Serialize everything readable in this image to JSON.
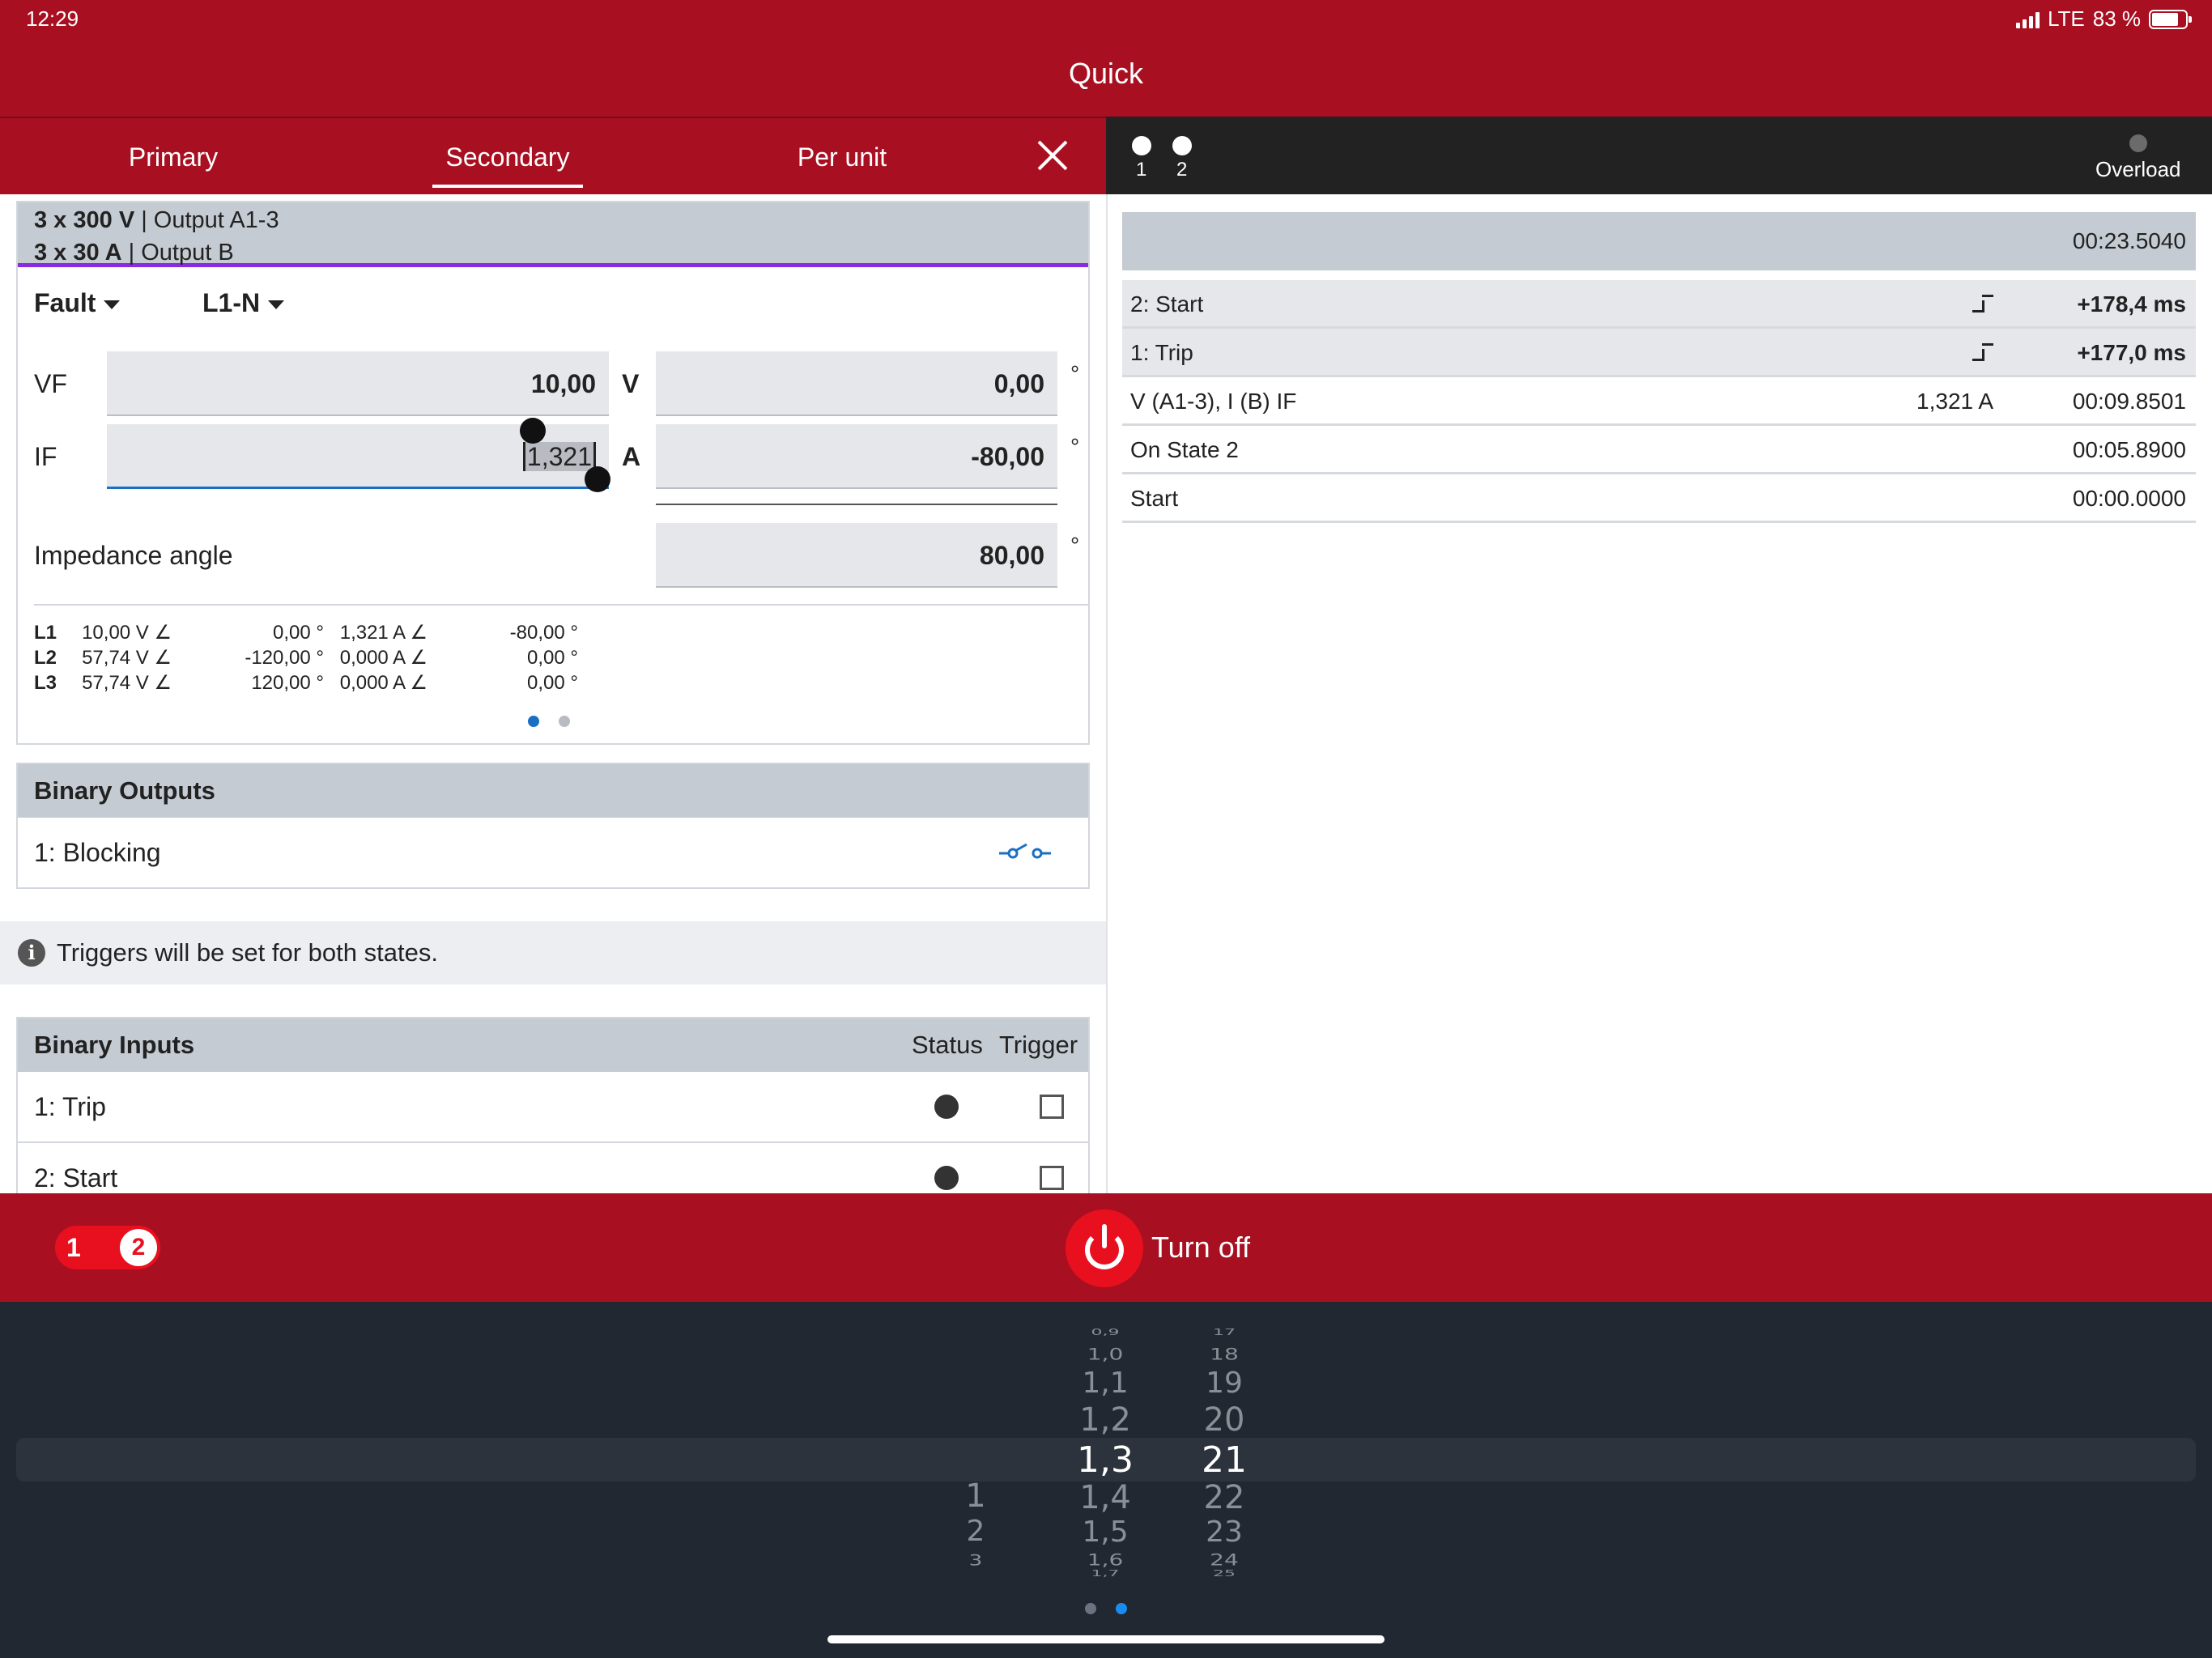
{
  "status_bar": {
    "time": "12:29",
    "network": "LTE",
    "battery": "83 %"
  },
  "app": {
    "title": "Quick"
  },
  "tabs": [
    {
      "label": "Primary"
    },
    {
      "label": "Secondary",
      "active": true
    },
    {
      "label": "Per unit"
    }
  ],
  "states_bar": {
    "states": [
      "1",
      "2"
    ],
    "overload_label": "Overload"
  },
  "output_config": {
    "voltage_range": "3 x 300 V",
    "voltage_output": "| Output A1-3",
    "current_range": "3 x 30 A",
    "current_output": "| Output B"
  },
  "selectors": {
    "fault_mode": "Fault",
    "loop": "L1-N"
  },
  "inputs": {
    "vf": {
      "label": "VF",
      "value": "10,00",
      "unit": "V",
      "angle": "0,00",
      "angle_unit": "°"
    },
    "if": {
      "label": "IF",
      "value": "1,321",
      "unit": "A",
      "angle": "-80,00",
      "angle_unit": "°"
    },
    "impedance_angle": {
      "label": "Impedance angle",
      "value": "80,00",
      "unit": "°"
    }
  },
  "phase_table": [
    {
      "phase": "L1",
      "v": "10,00 V ∠",
      "v_ang": "0,00 °",
      "i": "1,321 A ∠",
      "i_ang": "-80,00 °"
    },
    {
      "phase": "L2",
      "v": "57,74 V ∠",
      "v_ang": "-120,00 °",
      "i": "0,000 A ∠",
      "i_ang": "0,00 °"
    },
    {
      "phase": "L3",
      "v": "57,74 V ∠",
      "v_ang": "120,00 °",
      "i": "0,000 A ∠",
      "i_ang": "0,00 °"
    }
  ],
  "binary_outputs": {
    "title": "Binary Outputs",
    "items": [
      {
        "label": "1: Blocking"
      }
    ]
  },
  "info_message": "Triggers will be set for both states.",
  "binary_inputs": {
    "title": "Binary Inputs",
    "status_header": "Status",
    "trigger_header": "Trigger",
    "items": [
      {
        "label": "1: Trip"
      },
      {
        "label": "2: Start"
      }
    ]
  },
  "events": {
    "total_time": "00:23.5040",
    "rows": [
      {
        "label": "2: Start",
        "value": "",
        "time": "+178,4 ms"
      },
      {
        "label": "1: Trip",
        "value": "",
        "time": "+177,0 ms"
      },
      {
        "label": "V (A1-3), I (B) IF",
        "value": "1,321 A",
        "time": "00:09.8501"
      },
      {
        "label": "On State 2",
        "value": "",
        "time": "00:05.8900"
      },
      {
        "label": "Start",
        "value": "",
        "time": "00:00.0000"
      }
    ]
  },
  "bottom_bar": {
    "state_1": "1",
    "state_2": "2",
    "power_label": "Turn off"
  },
  "picker": {
    "col1": [
      "1",
      "2",
      "3"
    ],
    "col2": [
      "0,9",
      "1,0",
      "1,1",
      "1,2",
      "1,3",
      "1,4",
      "1,5",
      "1,6",
      "1,7"
    ],
    "col3": [
      "17",
      "18",
      "19",
      "20",
      "21",
      "22",
      "23",
      "24",
      "25"
    ],
    "selected": {
      "col2": "1,3",
      "col3": "21"
    }
  },
  "colors": {
    "brand_red": "#a81022",
    "accent_red": "#e8101e",
    "dark": "#222831",
    "link_blue": "#1a6fc4"
  }
}
